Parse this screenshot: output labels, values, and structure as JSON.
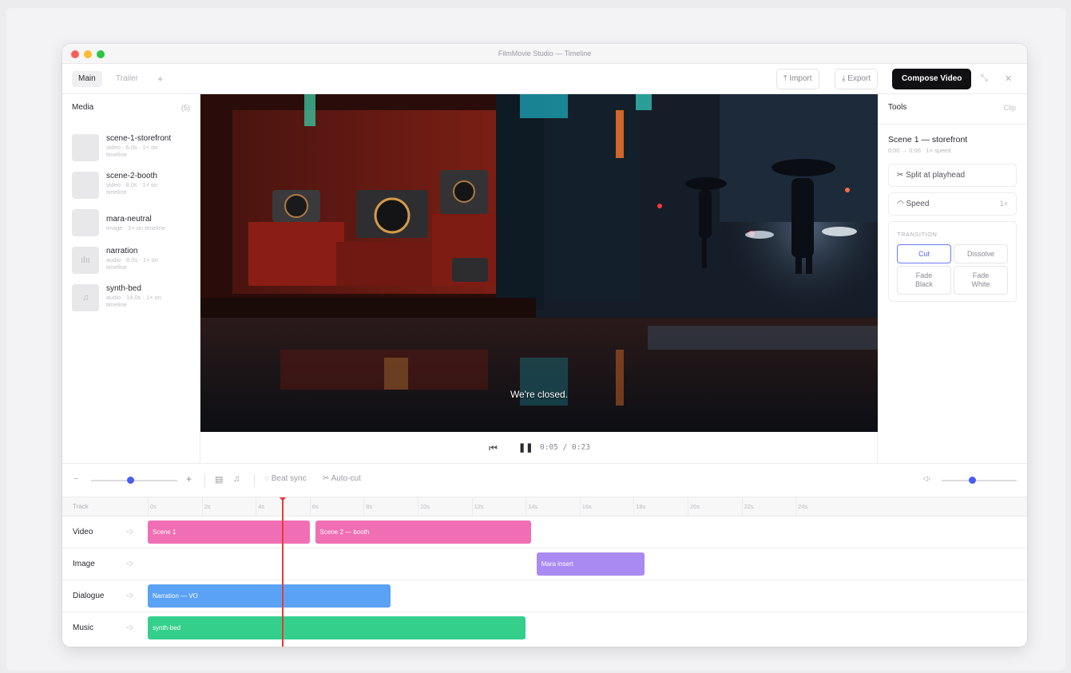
{
  "window": {
    "title": "FilmMovie Studio — Timeline"
  },
  "tabs": [
    {
      "label": "Main"
    },
    {
      "label": "Trailer"
    }
  ],
  "add_tab_icon": "+",
  "toolbar": {
    "import_label": "Import",
    "export_label": "Export",
    "compose_label": "Compose Video"
  },
  "media": {
    "title": "Media",
    "count": "(5)",
    "items": [
      {
        "name": "scene-1-storefront",
        "meta": "video · 6.0s · 1× on timeline",
        "icon": ""
      },
      {
        "name": "scene-2-booth",
        "meta": "video · 8.0s · 1× on timeline",
        "icon": ""
      },
      {
        "name": "mara-neutral",
        "meta": "image · 1× on timeline",
        "icon": ""
      },
      {
        "name": "narration",
        "meta": "audio · 8.0s · 1× on timeline",
        "icon": "ılıı"
      },
      {
        "name": "synth-bed",
        "meta": "audio · 14.0s · 1× on timeline",
        "icon": "♫"
      }
    ]
  },
  "preview": {
    "subtitle": "We're closed.",
    "time": "0:05 / 0:23"
  },
  "tools": {
    "title": "Tools",
    "clip_tab": "Clip",
    "clip_name": "Scene 1 — storefront",
    "clip_meta": "0:00 → 0:06 · 1× speed",
    "split_label": "Split at playhead",
    "speed_label": "Speed",
    "speed_value": "1×",
    "transition_title": "TRANSITION",
    "transitions": [
      "Cut",
      "Dissolve",
      "Fade Black",
      "Fade White"
    ],
    "selected_transition": "Cut"
  },
  "timeline": {
    "beat_sync_label": "Beat sync",
    "auto_cut_label": "Auto-cut",
    "track_header": "Track",
    "zoom_level": 0.45,
    "volume_level": 0.4,
    "ticks": [
      "0s",
      "2s",
      "4s",
      "6s",
      "8s",
      "10s",
      "12s",
      "14s",
      "16s",
      "18s",
      "20s",
      "22s",
      "24s"
    ],
    "playhead_time": "0:05",
    "tracks": [
      {
        "name": "Video",
        "clips": [
          {
            "label": "Scene 1",
            "start": 0,
            "end": 6,
            "color": "#f06fb4"
          },
          {
            "label": "Scene 2 — booth",
            "start": 6.2,
            "end": 14.2,
            "color": "#f06fb4"
          }
        ]
      },
      {
        "name": "Image",
        "clips": [
          {
            "label": "Mara insert",
            "start": 14.4,
            "end": 18.4,
            "color": "#a98af2"
          }
        ]
      },
      {
        "name": "Dialogue",
        "clips": [
          {
            "label": "Narration — VO",
            "start": 0,
            "end": 9.0,
            "color": "#5aa2f5"
          }
        ]
      },
      {
        "name": "Music",
        "clips": [
          {
            "label": "synth-bed",
            "start": 0,
            "end": 14.0,
            "color": "#35cf8c"
          }
        ]
      }
    ]
  },
  "colors": {
    "accent": "#4b5cf0",
    "playhead": "#e63b3b",
    "video_clip": "#f06fb4",
    "image_clip": "#a98af2",
    "dialogue_clip": "#5aa2f5",
    "music_clip": "#35cf8c"
  }
}
